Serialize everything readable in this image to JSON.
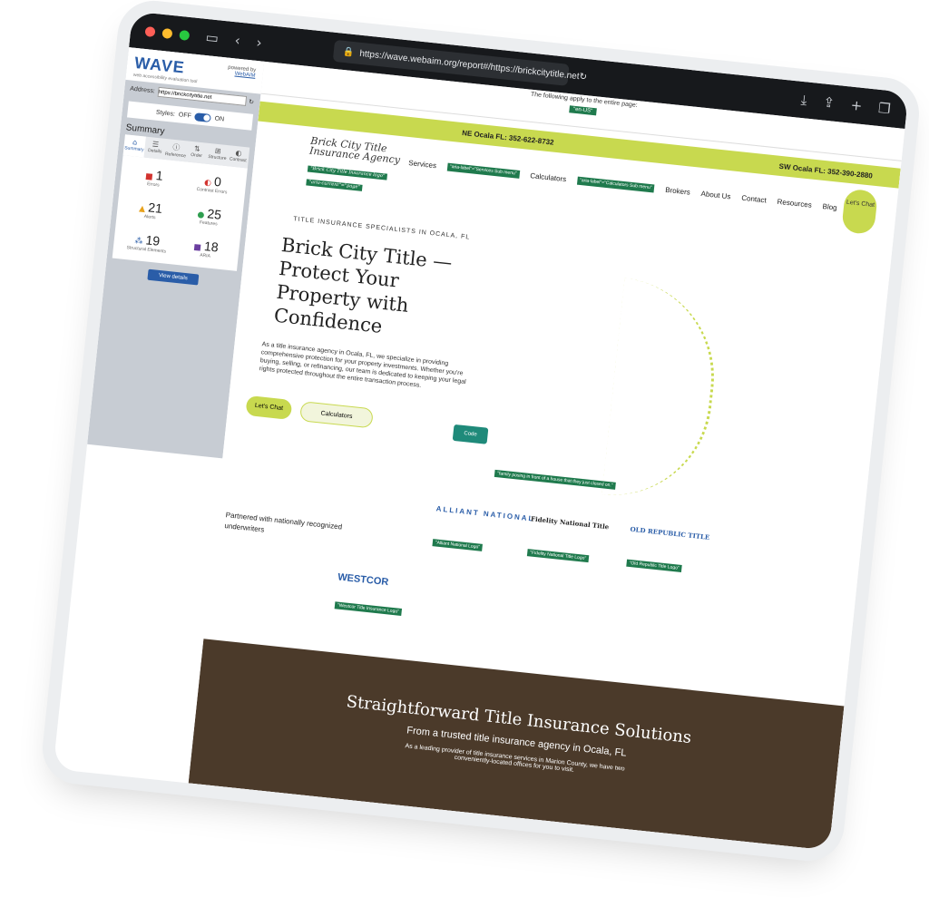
{
  "browser": {
    "url": "https://wave.webaim.org/report#/https://brickcitytitle.net"
  },
  "wave": {
    "logo": "WAVE",
    "tagline": "web accessibility evaluation tool",
    "powered_by": "powered by",
    "webaim": "WebAIM",
    "address_label": "Address:",
    "address_value": "https://brickcitytitle.net",
    "styles_label": "Styles:",
    "styles_off": "OFF",
    "styles_on": "ON",
    "summary_heading": "Summary",
    "tabs": [
      "Summary",
      "Details",
      "Reference",
      "Order",
      "Structure",
      "Contrast"
    ],
    "stats": [
      {
        "count": "1",
        "label": "Errors",
        "color": "#d2332f"
      },
      {
        "count": "0",
        "label": "Contrast Errors",
        "color": "#d2332f"
      },
      {
        "count": "21",
        "label": "Alerts",
        "color": "#e8a21c"
      },
      {
        "count": "25",
        "label": "Features",
        "color": "#2f9e4f"
      },
      {
        "count": "19",
        "label": "Structural Elements",
        "color": "#2a5da8"
      },
      {
        "count": "18",
        "label": "ARIA",
        "color": "#6b3fa0"
      }
    ],
    "view_details": "View details"
  },
  "site": {
    "apply_text": "The following apply to the entire page:",
    "lang_tag": "\"en-US\"",
    "ne_phone": "NE Ocala FL: 352-622-8732",
    "sw_phone": "SW Ocala FL: 352-390-2880",
    "logo_line1": "Brick City Title",
    "logo_line2": "Insurance Agency",
    "logo_alt": "\"Brick City Title Insurance logo\"",
    "menu": [
      "Services",
      "Calculators",
      "Brokers",
      "About Us",
      "Contact",
      "Resources",
      "Blog"
    ],
    "aria_services": "\"aria-label\"=\"Services Sub menu\"",
    "aria_calc": "\"aria-label\"=\"Calculators Sub menu\"",
    "aria_current": "\"aria-current\"=\"page\"",
    "chat_pill": "Let's Chat",
    "eyebrow": "TITLE INSURANCE SPECIALISTS IN OCALA, FL",
    "hero_title": "Brick City Title — Protect Your Property with Confidence",
    "hero_text": "As a title insurance agency in Ocala, FL, we specialize in providing comprehensive protection for your property investments. Whether you're buying, selling, or refinancing, our team is dedicated to keeping your legal rights protected throughout the entire transaction process.",
    "btn_chat": "Let's Chat",
    "btn_calc": "Calculators",
    "code_label": "Code",
    "photo_alt": "\"family posing in front of a house that they just closed on.\"",
    "partners_heading": "Partnered with nationally recognized underwriters",
    "partners": [
      {
        "name": "ALLIANT NATIONAL",
        "alt": "\"Alliant National Logo\""
      },
      {
        "name": "Fidelity National Title",
        "alt": "\"Fidelity National Title Logo\""
      },
      {
        "name": "OLD REPUBLIC TITLE",
        "alt": "\"Old Republic Title Logo\""
      },
      {
        "name": "WESTCOR",
        "alt": "\"Westcor Title Insurance Logo\""
      }
    ],
    "section_title": "Straightforward Title Insurance Solutions",
    "section_sub": "From a trusted title insurance agency in Ocala, FL",
    "section_text": "As a leading provider of title insurance services in Marion County, we have two conveniently-located offices for you to visit."
  }
}
